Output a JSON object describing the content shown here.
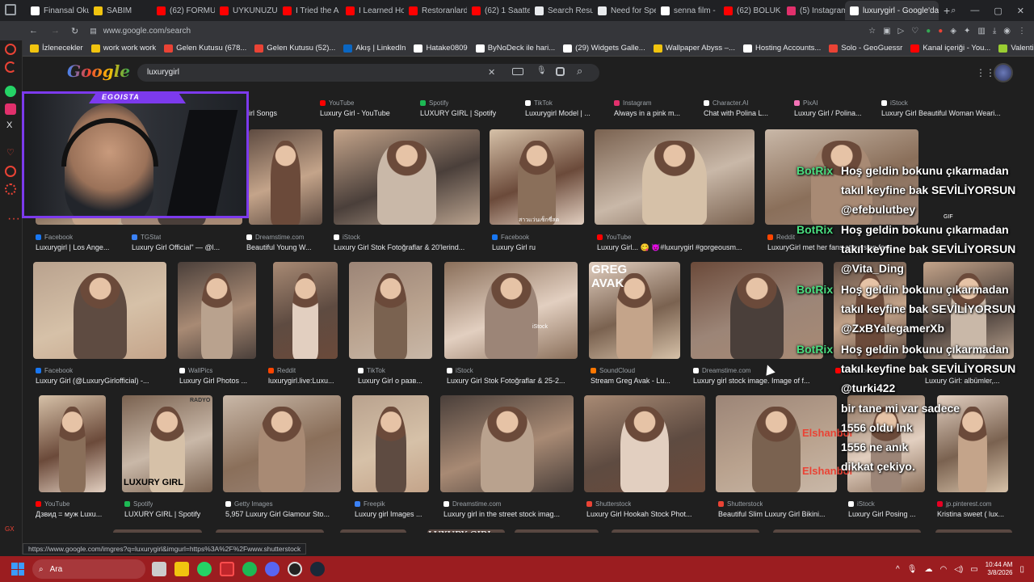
{
  "tabs": [
    {
      "label": "Finansal Oku",
      "color": "#fff"
    },
    {
      "label": "SABIM",
      "color": "#f1c40f"
    },
    {
      "label": "(62) FORMU",
      "color": "#ff0000"
    },
    {
      "label": "UYKUNUZU",
      "color": "#ff0000"
    },
    {
      "label": "I Tried the A",
      "color": "#ff0000"
    },
    {
      "label": "I Learned Ho",
      "color": "#ff0000"
    },
    {
      "label": "Restoranlard",
      "color": "#ff0000"
    },
    {
      "label": "(62) 1 Saatte",
      "color": "#ff0000"
    },
    {
      "label": "Search Resu",
      "color": "#e8eaed"
    },
    {
      "label": "Need for Spe",
      "color": "#e8eaed"
    },
    {
      "label": "senna film -",
      "color": "#fff"
    },
    {
      "label": "(62) BOLUK",
      "color": "#ff0000"
    },
    {
      "label": "(5) Instagram",
      "color": "#e1306c"
    },
    {
      "label": "luxurygirl - Google'da A",
      "color": "#fff",
      "active": true
    }
  ],
  "address": {
    "url": "www.google.com/search"
  },
  "bookmarks": [
    {
      "label": "İzlenecekler",
      "color": "#f1c40f"
    },
    {
      "label": "work work work",
      "color": "#f1c40f"
    },
    {
      "label": "Gelen Kutusu (678...",
      "color": "#ea4335"
    },
    {
      "label": "Gelen Kutusu (52)...",
      "color": "#ea4335"
    },
    {
      "label": "Akış | LinkedIn",
      "color": "#0a66c2"
    },
    {
      "label": "Hatake0809",
      "color": "#fff"
    },
    {
      "label": "ByNoDeck ile hari...",
      "color": "#fff"
    },
    {
      "label": "(29) Widgets Galle...",
      "color": "#fff"
    },
    {
      "label": "Wallpaper Abyss –...",
      "color": "#f1c40f"
    },
    {
      "label": "Hosting Accounts...",
      "color": "#fff"
    },
    {
      "label": "Solo - GeoGuessr",
      "color": "#ea4335"
    },
    {
      "label": "Kanal içeriği - You...",
      "color": "#ff0000"
    },
    {
      "label": "Valentine's Day Pr...",
      "color": "#9acd32"
    }
  ],
  "search": {
    "query": "luxurygirl",
    "logo": "Google"
  },
  "webcam": {
    "overlay_label": "EGOISTA"
  },
  "results": [
    {
      "src": "YouTube",
      "cap": "Luxury Girl - YouTube",
      "sc": "#ff0000"
    },
    {
      "src": "Spotify",
      "cap": "LUXURY GIRL | Spotify",
      "sc": "#1db954"
    },
    {
      "src": "TikTok",
      "cap": "Luxurygirl Model | ...",
      "sc": "#fff"
    },
    {
      "src": "Instagram",
      "cap": "Always in a pink m...",
      "sc": "#e1306c"
    },
    {
      "src": "Character.AI",
      "cap": "Chat with Polina L...",
      "sc": "#fff"
    },
    {
      "src": "PixAI",
      "cap": "Luxury Girl / Polina...",
      "sc": "#f472b6"
    },
    {
      "src": "iStock",
      "cap": "Luxury Girl Beautiful Woman Weari...",
      "sc": "#fff"
    },
    {
      "src": "",
      "cap": "irl Songs",
      "sc": "#fff"
    },
    {
      "src": "Facebook",
      "cap": "Luxurygirl | Los Ange...",
      "sc": "#1877f2"
    },
    {
      "src": "TGStat",
      "cap": "Luxury Girl Official\" — @l...",
      "sc": "#3b82f6"
    },
    {
      "src": "Dreamstime.com",
      "cap": "Beautiful Young W...",
      "sc": "#fff"
    },
    {
      "src": "iStock",
      "cap": "Luxury Girl Stok Fotoğraflar & 20'lerind...",
      "sc": "#fff"
    },
    {
      "src": "Facebook",
      "cap": "Luxury Girl ru",
      "sc": "#1877f2"
    },
    {
      "src": "YouTube",
      "cap": "Luxury Girl... 😋 😈#luxurygirl #gorgeousm...",
      "sc": "#ff0000"
    },
    {
      "src": "Reddit",
      "cap": "LuxuryGirl met her fans at russian fest...",
      "sc": "#ff4500"
    },
    {
      "src": "Facebook",
      "cap": "Luxury Girl (@LuxuryGirlofficial) -...",
      "sc": "#1877f2"
    },
    {
      "src": "WallPics",
      "cap": "Luxury Girl Photos ...",
      "sc": "#fff"
    },
    {
      "src": "Reddit",
      "cap": "luxurygirl.live:Luxu...",
      "sc": "#ff4500"
    },
    {
      "src": "TikTok",
      "cap": "Luxury Girl о разв...",
      "sc": "#fff"
    },
    {
      "src": "iStock",
      "cap": "Luxury Girl Stok Fotoğraflar & 25-2...",
      "sc": "#fff"
    },
    {
      "src": "SoundCloud",
      "cap": "Stream Greg Avak - Lu...",
      "sc": "#ff7700"
    },
    {
      "src": "Dreamstime.com",
      "cap": "Luxury girl stock image. Image of f...",
      "sc": "#fff"
    },
    {
      "src": "YouTube",
      "cap": "",
      "sc": "#ff0000"
    },
    {
      "src": "",
      "cap": "Luxury Girl: albümler,...",
      "sc": "#fff"
    },
    {
      "src": "YouTube",
      "cap": "Дзвид = муж Luxu...",
      "sc": "#ff0000"
    },
    {
      "src": "Spotify",
      "cap": "LUXURY GIRL | Spotify",
      "sc": "#1db954"
    },
    {
      "src": "Getty Images",
      "cap": "5,957 Luxury Girl Glamour Sto...",
      "sc": "#fff"
    },
    {
      "src": "Freepik",
      "cap": "Luxury girl Images ...",
      "sc": "#3b82f6"
    },
    {
      "src": "Dreamstime.com",
      "cap": "Luxury girl in the street stock imag...",
      "sc": "#fff"
    },
    {
      "src": "Shutterstock",
      "cap": "Luxury Girl Hookah Stock Phot...",
      "sc": "#ea4335"
    },
    {
      "src": "Shutterstock",
      "cap": "Beautiful Slim Luxury Girl Bikini...",
      "sc": "#ea4335"
    },
    {
      "src": "iStock",
      "cap": "Luxury Girl Posing ...",
      "sc": "#fff"
    },
    {
      "src": "jp.pinterest.com",
      "cap": "Kristina sweet ( lux...",
      "sc": "#e60023"
    }
  ],
  "image_texts": {
    "istock": "iStock",
    "greg_avak": "GREG\nAVAK",
    "luxury_girl_card": "LUXURY GIRL",
    "radyo": "RADYO",
    "luxury_girl_banner": "LUXURY GIRL",
    "gif": "GIF",
    "thai": "สาวแว่นเซ็กซี่สด",
    "elsh1": "Elshanboi",
    "elsh2": "Elshanboi"
  },
  "chat": {
    "bot": "BotRix",
    "welcome1": "Hoş geldin bokunu çıkarmadan",
    "welcome2": "takıl keyfine bak SEVİLİYORSUN",
    "users": [
      "@efebulutbey",
      "@Vita_Ding",
      "@ZxBYalegamerXb",
      "@turki422"
    ],
    "msg1": "bir tane mi var sadece",
    "msg2": "1556 oldu lnk",
    "msg3": "1556 ne anık",
    "msg4": "dikkat çekiyo."
  },
  "status_url": "https://www.google.com/imgres?q=luxurygirl&imgurl=https%3A%2F%2Fwww.shutterstock",
  "taskbar": {
    "search_label": "Ara",
    "time": "10:44 AM",
    "date": "3/8/2026"
  }
}
